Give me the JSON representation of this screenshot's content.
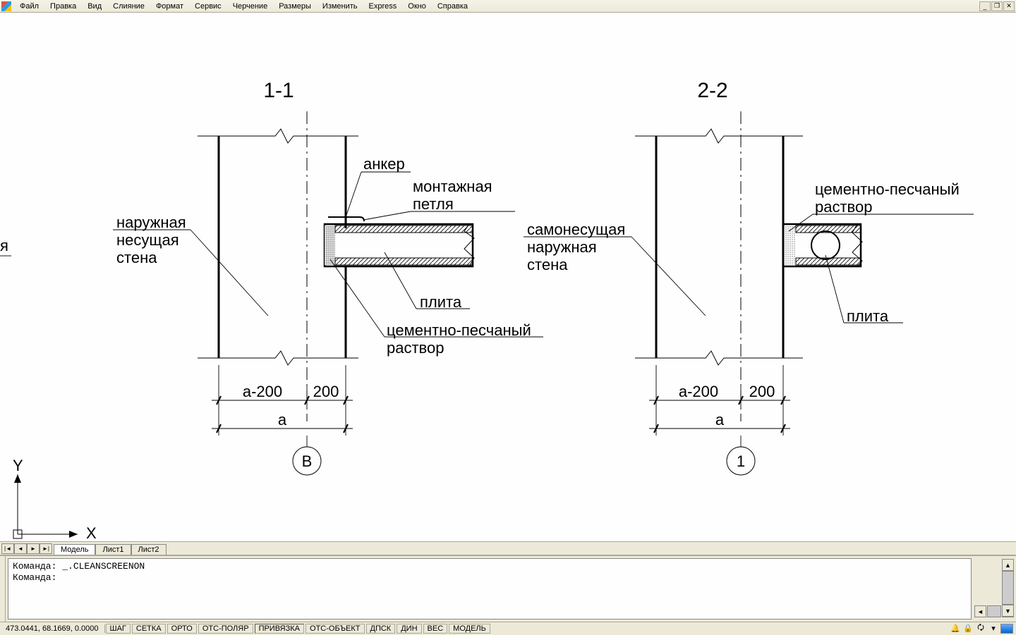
{
  "menu": {
    "items": [
      "Файл",
      "Правка",
      "Вид",
      "Слияние",
      "Формат",
      "Сервис",
      "Черчение",
      "Размеры",
      "Изменить",
      "Express",
      "Окно",
      "Справка"
    ]
  },
  "drawing": {
    "section1_title": "1-1",
    "section2_title": "2-2",
    "labels": {
      "anchor": "анкер",
      "mounting_loop_l1": "монтажная",
      "mounting_loop_l2": "петля",
      "plate": "плита",
      "cement_l1": "цементно-песчаный",
      "cement_l2": "раствор",
      "ext_bearing_l1": "наружная",
      "ext_bearing_l2": "несущая",
      "ext_bearing_l3": "стена",
      "self_bearing_l1": "самонесущая",
      "self_bearing_l2": "наружная",
      "self_bearing_l3": "стена",
      "cropped_ya": "я"
    },
    "dims": {
      "a_minus_200": "а-200",
      "two_hundred": "200",
      "a": "а"
    },
    "axis_b": "В",
    "axis_1": "1",
    "ucs_x": "X",
    "ucs_y": "Y"
  },
  "tabs": {
    "model": "Модель",
    "sheet1": "Лист1",
    "sheet2": "Лист2"
  },
  "cmd": {
    "line1": "Команда: _.CLEANSCREENON",
    "line2": "Команда:"
  },
  "status": {
    "coords": "473.0441, 68.1669, 0.0000",
    "toggles": [
      "ШАГ",
      "СЕТКА",
      "ОРТО",
      "ОТС-ПОЛЯР",
      "ПРИВЯЗКА",
      "ОТС-ОБЪЕКТ",
      "ДПСК",
      "ДИН",
      "ВЕС",
      "МОДЕЛЬ"
    ],
    "pressed": [
      false,
      false,
      false,
      false,
      true,
      false,
      false,
      false,
      false,
      false
    ]
  }
}
